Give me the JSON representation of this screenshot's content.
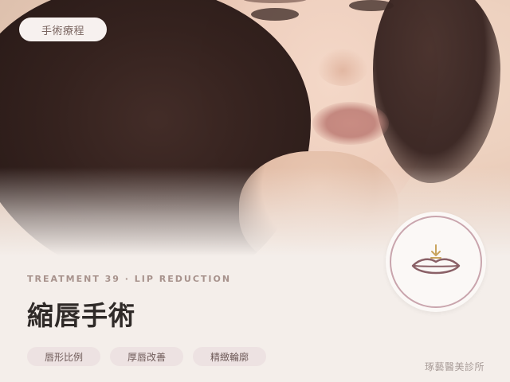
{
  "badge": {
    "label": "手術療程"
  },
  "treatment": {
    "eyebrow": "TREATMENT 39 · LIP REDUCTION",
    "title": "縮唇手術"
  },
  "tags": [
    "唇形比例",
    "厚唇改善",
    "精緻輪廓"
  ],
  "clinic": {
    "name": "琢藝醫美診所"
  },
  "icon": {
    "name": "lip-reduction-icon"
  },
  "colors": {
    "background": "#f4eeea",
    "accent_ring": "#c9a5ad",
    "lip_stroke": "#8a6066",
    "arrow": "#c9a45e",
    "tag_bg": "#ede2e2",
    "title_text": "#2f2a28"
  }
}
